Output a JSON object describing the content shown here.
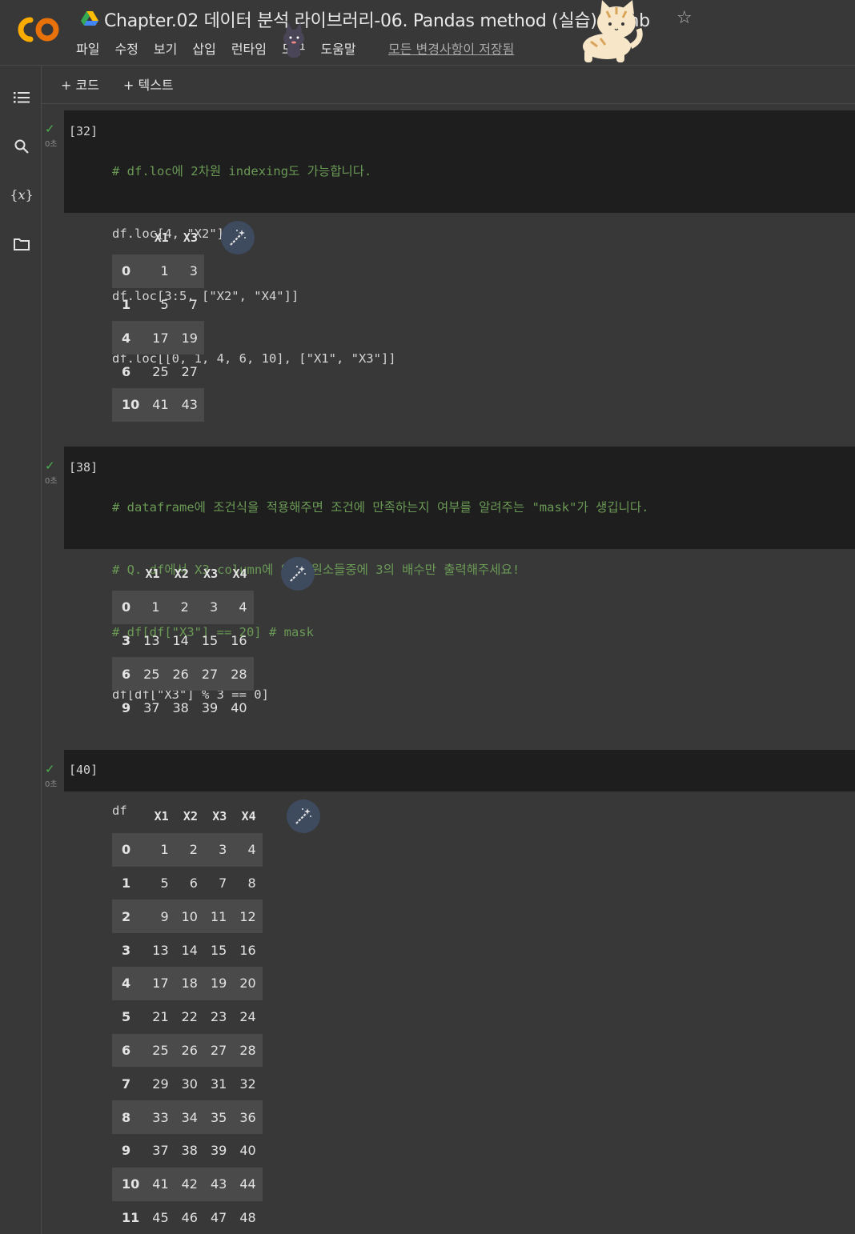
{
  "header": {
    "title": "Chapter.02 데이터 분석 라이브러리-06. Pandas method (실습).ipynb",
    "menu": [
      "파일",
      "수정",
      "보기",
      "삽입",
      "런타임",
      "도구",
      "도움말"
    ],
    "saved_status": "모든 변경사항이 저장됨",
    "logo_text": "CO"
  },
  "toolbar": {
    "add_code": "+ 코드",
    "add_text": "+ 텍스트"
  },
  "cells": [
    {
      "prompt": "[32]",
      "duration": "0초",
      "code_lines": [
        "# df.loc에 2차원 indexing도 가능합니다.",
        "df.loc[4, \"X2\"]",
        "df.loc[3:5, [\"X2\", \"X4\"]]",
        "df.loc[[0, 1, 4, 6, 10], [\"X1\", \"X3\"]]"
      ],
      "output": {
        "columns": [
          "X1",
          "X3"
        ],
        "rows": [
          {
            "index": "0",
            "values": [
              "1",
              "3"
            ]
          },
          {
            "index": "1",
            "values": [
              "5",
              "7"
            ]
          },
          {
            "index": "4",
            "values": [
              "17",
              "19"
            ]
          },
          {
            "index": "6",
            "values": [
              "25",
              "27"
            ]
          },
          {
            "index": "10",
            "values": [
              "41",
              "43"
            ]
          }
        ]
      }
    },
    {
      "prompt": "[38]",
      "duration": "0초",
      "code_lines": [
        "# dataframe에 조건식을 적용해주면 조건에 만족하는지 여부를 알려주는 \"mask\"가 생깁니다.",
        "# Q. df에서 X3 column에 있는 원소들중에 3의 배수만 출력해주세요!",
        "# df[df[\"X3\"] == 20] # mask",
        "df[df[\"X3\"] % 3 == 0]"
      ],
      "output": {
        "columns": [
          "X1",
          "X2",
          "X3",
          "X4"
        ],
        "rows": [
          {
            "index": "0",
            "values": [
              "1",
              "2",
              "3",
              "4"
            ]
          },
          {
            "index": "3",
            "values": [
              "13",
              "14",
              "15",
              "16"
            ]
          },
          {
            "index": "6",
            "values": [
              "25",
              "26",
              "27",
              "28"
            ]
          },
          {
            "index": "9",
            "values": [
              "37",
              "38",
              "39",
              "40"
            ]
          }
        ]
      }
    },
    {
      "prompt": "[40]",
      "duration": "0초",
      "code_lines": [
        "df"
      ],
      "output": {
        "columns": [
          "X1",
          "X2",
          "X3",
          "X4"
        ],
        "rows": [
          {
            "index": "0",
            "values": [
              "1",
              "2",
              "3",
              "4"
            ]
          },
          {
            "index": "1",
            "values": [
              "5",
              "6",
              "7",
              "8"
            ]
          },
          {
            "index": "2",
            "values": [
              "9",
              "10",
              "11",
              "12"
            ]
          },
          {
            "index": "3",
            "values": [
              "13",
              "14",
              "15",
              "16"
            ]
          },
          {
            "index": "4",
            "values": [
              "17",
              "18",
              "19",
              "20"
            ]
          },
          {
            "index": "5",
            "values": [
              "21",
              "22",
              "23",
              "24"
            ]
          },
          {
            "index": "6",
            "values": [
              "25",
              "26",
              "27",
              "28"
            ]
          },
          {
            "index": "7",
            "values": [
              "29",
              "30",
              "31",
              "32"
            ]
          },
          {
            "index": "8",
            "values": [
              "33",
              "34",
              "35",
              "36"
            ]
          },
          {
            "index": "9",
            "values": [
              "37",
              "38",
              "39",
              "40"
            ]
          },
          {
            "index": "10",
            "values": [
              "41",
              "42",
              "43",
              "44"
            ]
          },
          {
            "index": "11",
            "values": [
              "45",
              "46",
              "47",
              "48"
            ]
          }
        ]
      }
    }
  ],
  "icons": {
    "check": "check-icon",
    "magic": "magic-wand-icon",
    "rail": [
      "toc-icon",
      "search-icon",
      "variables-icon",
      "folder-icon"
    ]
  },
  "colors": {
    "accent_orange": "#f9ab00",
    "check_green": "#4caf50",
    "comment_green": "#6a9955",
    "string_orange": "#ce9178"
  }
}
